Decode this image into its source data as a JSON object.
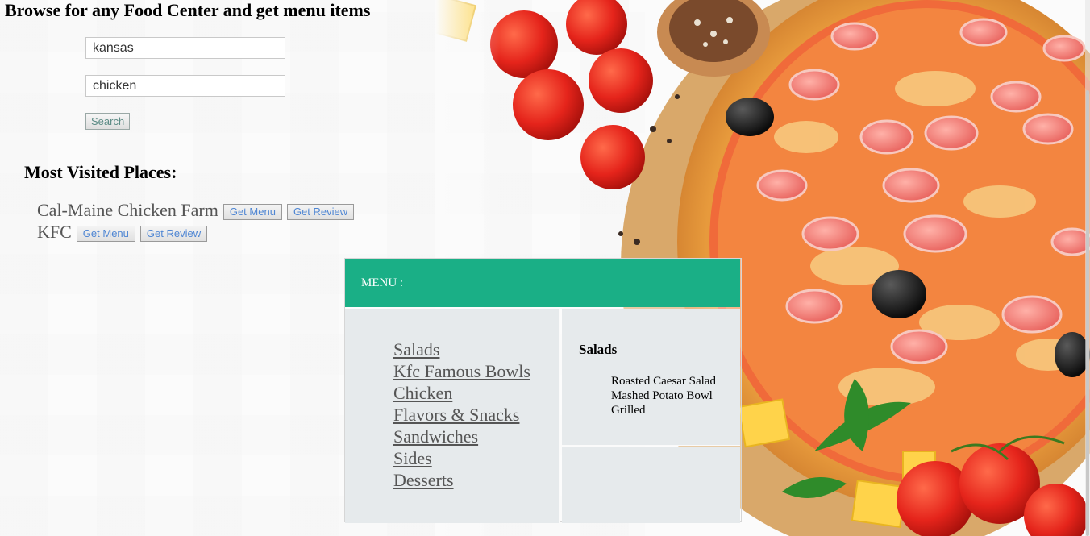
{
  "header": {
    "title": "Browse for any Food Center and get menu items"
  },
  "search": {
    "location_value": "kansas",
    "query_value": "chicken",
    "button_label": "Search"
  },
  "most_visited": {
    "title": "Most Visited Places:",
    "places": [
      {
        "name": "Cal-Maine Chicken Farm",
        "menu_label": "Get Menu",
        "review_label": "Get Review"
      },
      {
        "name": "KFC",
        "menu_label": "Get Menu",
        "review_label": "Get Review"
      }
    ]
  },
  "menu": {
    "header": "MENU :",
    "categories": [
      "Salads",
      "Kfc Famous Bowls",
      "Chicken",
      "Flavors & Snacks",
      "Sandwiches",
      "Sides",
      "Desserts"
    ],
    "selected_category": "Salads",
    "items": [
      "Roasted Caesar Salad",
      "Mashed Potato Bowl",
      "Grilled"
    ]
  },
  "colors": {
    "menu_header": "#1aaf86",
    "panel_bg": "#e6eaec",
    "link_text": "#4f86d3"
  }
}
